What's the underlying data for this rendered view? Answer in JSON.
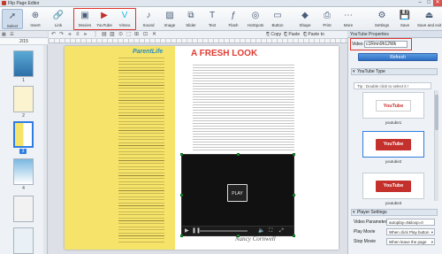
{
  "window": {
    "title": "Flip Page Editor",
    "controls": [
      "–",
      "□",
      "✕"
    ]
  },
  "ribbon": {
    "items": [
      {
        "label": "Select",
        "icon": "cursor-icon",
        "glyph": "➚",
        "active": true
      },
      {
        "label": "Insert",
        "icon": "insert-icon",
        "glyph": "⊕"
      },
      {
        "label": "Link",
        "icon": "link-icon",
        "glyph": "🔗"
      },
      {
        "label": "Movies",
        "icon": "movie-icon",
        "glyph": "▣"
      },
      {
        "label": "YouTube",
        "icon": "youtube-icon",
        "glyph": "▶"
      },
      {
        "label": "Vimeo",
        "icon": "vimeo-icon",
        "glyph": "V"
      },
      {
        "label": "Sound",
        "icon": "sound-icon",
        "glyph": "♪"
      },
      {
        "label": "Image",
        "icon": "image-icon",
        "glyph": "▨"
      },
      {
        "label": "Slider",
        "icon": "slider-icon",
        "glyph": "⧉"
      },
      {
        "label": "Text",
        "icon": "text-icon",
        "glyph": "T"
      },
      {
        "label": "Flash",
        "icon": "flash-icon",
        "glyph": "ƒ"
      },
      {
        "label": "HotSpots",
        "icon": "hotspot-icon",
        "glyph": "◎"
      },
      {
        "label": "Button",
        "icon": "button-icon",
        "glyph": "▭"
      },
      {
        "label": "Shape",
        "icon": "shape-icon",
        "glyph": "◆"
      },
      {
        "label": "Print",
        "icon": "print-icon",
        "glyph": "⎙"
      },
      {
        "label": "More",
        "icon": "more-icon",
        "glyph": "⋯"
      },
      {
        "label": "Settings",
        "icon": "gear-icon",
        "glyph": "⚙"
      },
      {
        "label": "Save",
        "icon": "save-icon",
        "glyph": "💾"
      },
      {
        "label": "Save and exit",
        "icon": "exit-icon",
        "glyph": "⏏"
      }
    ]
  },
  "left_panel": {
    "page_indicator": "2/15",
    "thumbnails": [
      "1",
      "2",
      "3",
      "4"
    ],
    "selected_page": "3"
  },
  "canvas_toolbar": {
    "copy": "Copy",
    "paste": "Paste",
    "paste_to": "Paste to"
  },
  "page": {
    "logo": "ParentLife",
    "headline": "A FRESH LOOK",
    "video_play": "PLAY",
    "signature": "Nancy Cornwell"
  },
  "right_panel": {
    "header": "YouTube Properties",
    "video_id_label": "Video ID",
    "video_id_value": "c1Rmn9h12Wk",
    "refresh_label": "Refresh",
    "youtube_type_header": "YouTube Type",
    "tip": "Tip : Double click to select it !",
    "styles": [
      {
        "name": "youtube1",
        "logo": "YouTube",
        "style": "white"
      },
      {
        "name": "youtube2",
        "logo": "YouTube",
        "style": "red"
      },
      {
        "name": "youtube3",
        "logo": "YouTube",
        "style": "red"
      }
    ],
    "player_settings_header": "Player Settings",
    "params": [
      {
        "label": "Video Parameters",
        "value": "autoplay=0&loop=0"
      },
      {
        "label": "Play Movie",
        "value": "When click Play button"
      },
      {
        "label": "Stop Movie",
        "value": "When leave the page"
      }
    ]
  }
}
